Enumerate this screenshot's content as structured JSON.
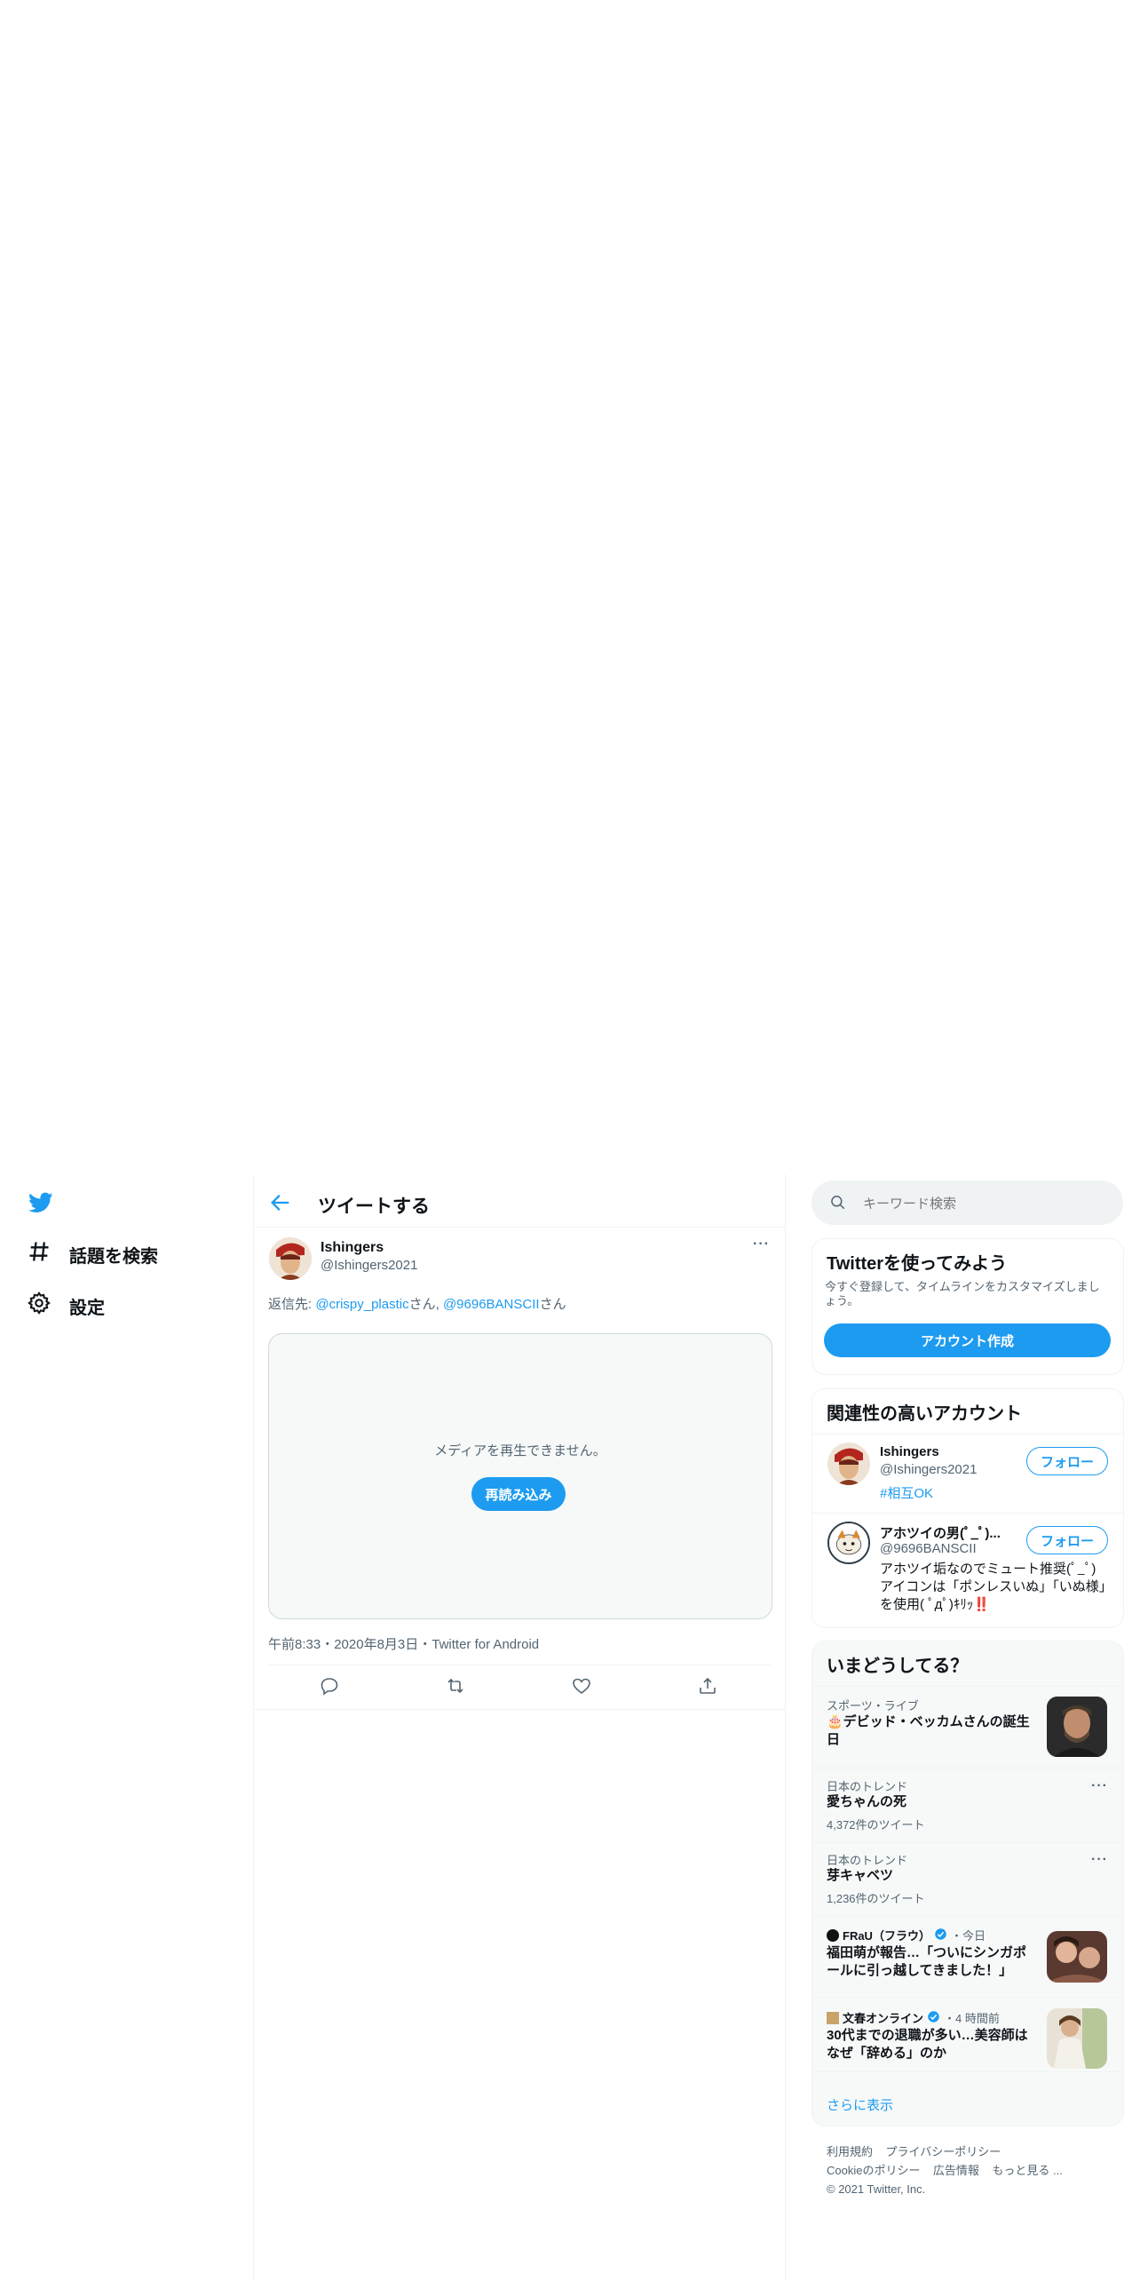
{
  "nav": {
    "explore_label": "話題を検索",
    "settings_label": "設定"
  },
  "header": {
    "title": "ツイートする"
  },
  "tweet": {
    "author_name": "Ishingers",
    "author_handle": "@Ishingers2021",
    "reply_prefix": "返信先: ",
    "reply_user1": "@crispy_plastic",
    "reply_suffix1": "さん, ",
    "reply_user2": "@9696BANSCII",
    "reply_suffix2": "さん",
    "media_error": "メディアを再生できません。",
    "reload_label": "再読み込み",
    "meta": "午前8:33・2020年8月3日・Twitter for Android"
  },
  "search": {
    "placeholder": "キーワード検索"
  },
  "signup": {
    "title": "Twitterを使ってみよう",
    "desc": "今すぐ登録して、タイムラインをカスタマイズしましょう。",
    "button": "アカウント作成"
  },
  "related": {
    "title": "関連性の高いアカウント",
    "accounts": [
      {
        "name": "Ishingers",
        "handle": "@Ishingers2021",
        "bio": "#相互OK",
        "follow": "フォロー"
      },
      {
        "name": "アホツイの男(ﾟ_ﾟ)...",
        "handle": "@9696BANSCII",
        "bio": "アホツイ垢なのでミュート推奨(ﾟ_ﾟ) アイコンは「ポンレスいぬ」「いぬ様」を使用( ﾟдﾟ)ｷﾘｯ‼️",
        "follow": "フォロー"
      }
    ]
  },
  "trends": {
    "title": "いまどうしてる？",
    "items": [
      {
        "category": "スポーツ・ライブ",
        "title": "🎂デビッド・ベッカムさんの誕生日"
      },
      {
        "category": "日本のトレンド",
        "title": "愛ちゃんの死",
        "count": "4,372件のツイート"
      },
      {
        "category": "日本のトレンド",
        "title": "芽キャベツ",
        "count": "1,236件のツイート"
      },
      {
        "source": "FRaU（フラウ）",
        "time": "・今日",
        "title": "福田萌が報告…「ついにシンガポールに引っ越してきました！」"
      },
      {
        "source": "文春オンライン",
        "time": "・4 時間前",
        "title": "30代までの退職が多い…美容師はなぜ「辞める」のか"
      }
    ],
    "show_more": "さらに表示"
  },
  "footer": {
    "terms": "利用規約",
    "privacy": "プライバシーポリシー",
    "cookie": "Cookieのポリシー",
    "ads": "広告情報",
    "more": "もっと見る ...",
    "copyright": "© 2021 Twitter, Inc."
  },
  "colors": {
    "accent": "#1d9bf0",
    "text": "#0f1419",
    "secondary": "#536471",
    "border": "#eff3f4",
    "card_bg": "#f7f9f9"
  }
}
